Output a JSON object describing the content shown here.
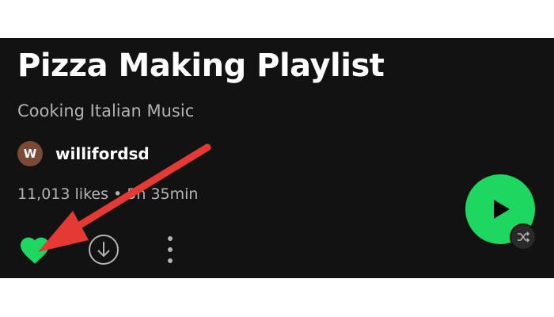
{
  "playlist": {
    "title": "Pizza Making Playlist",
    "description": "Cooking Italian Music",
    "owner": {
      "avatar_initial": "W",
      "name": "willifordsd"
    },
    "stats": "11,013 likes • 5h 35min"
  },
  "controls": {
    "like_icon": "heart-icon",
    "download_icon": "download-icon",
    "more_icon": "more-options-icon",
    "play_icon": "play-icon",
    "shuffle_icon": "shuffle-icon"
  },
  "colors": {
    "background": "#121212",
    "accent_green": "#1ed760",
    "annotation_arrow": "#e53935"
  }
}
